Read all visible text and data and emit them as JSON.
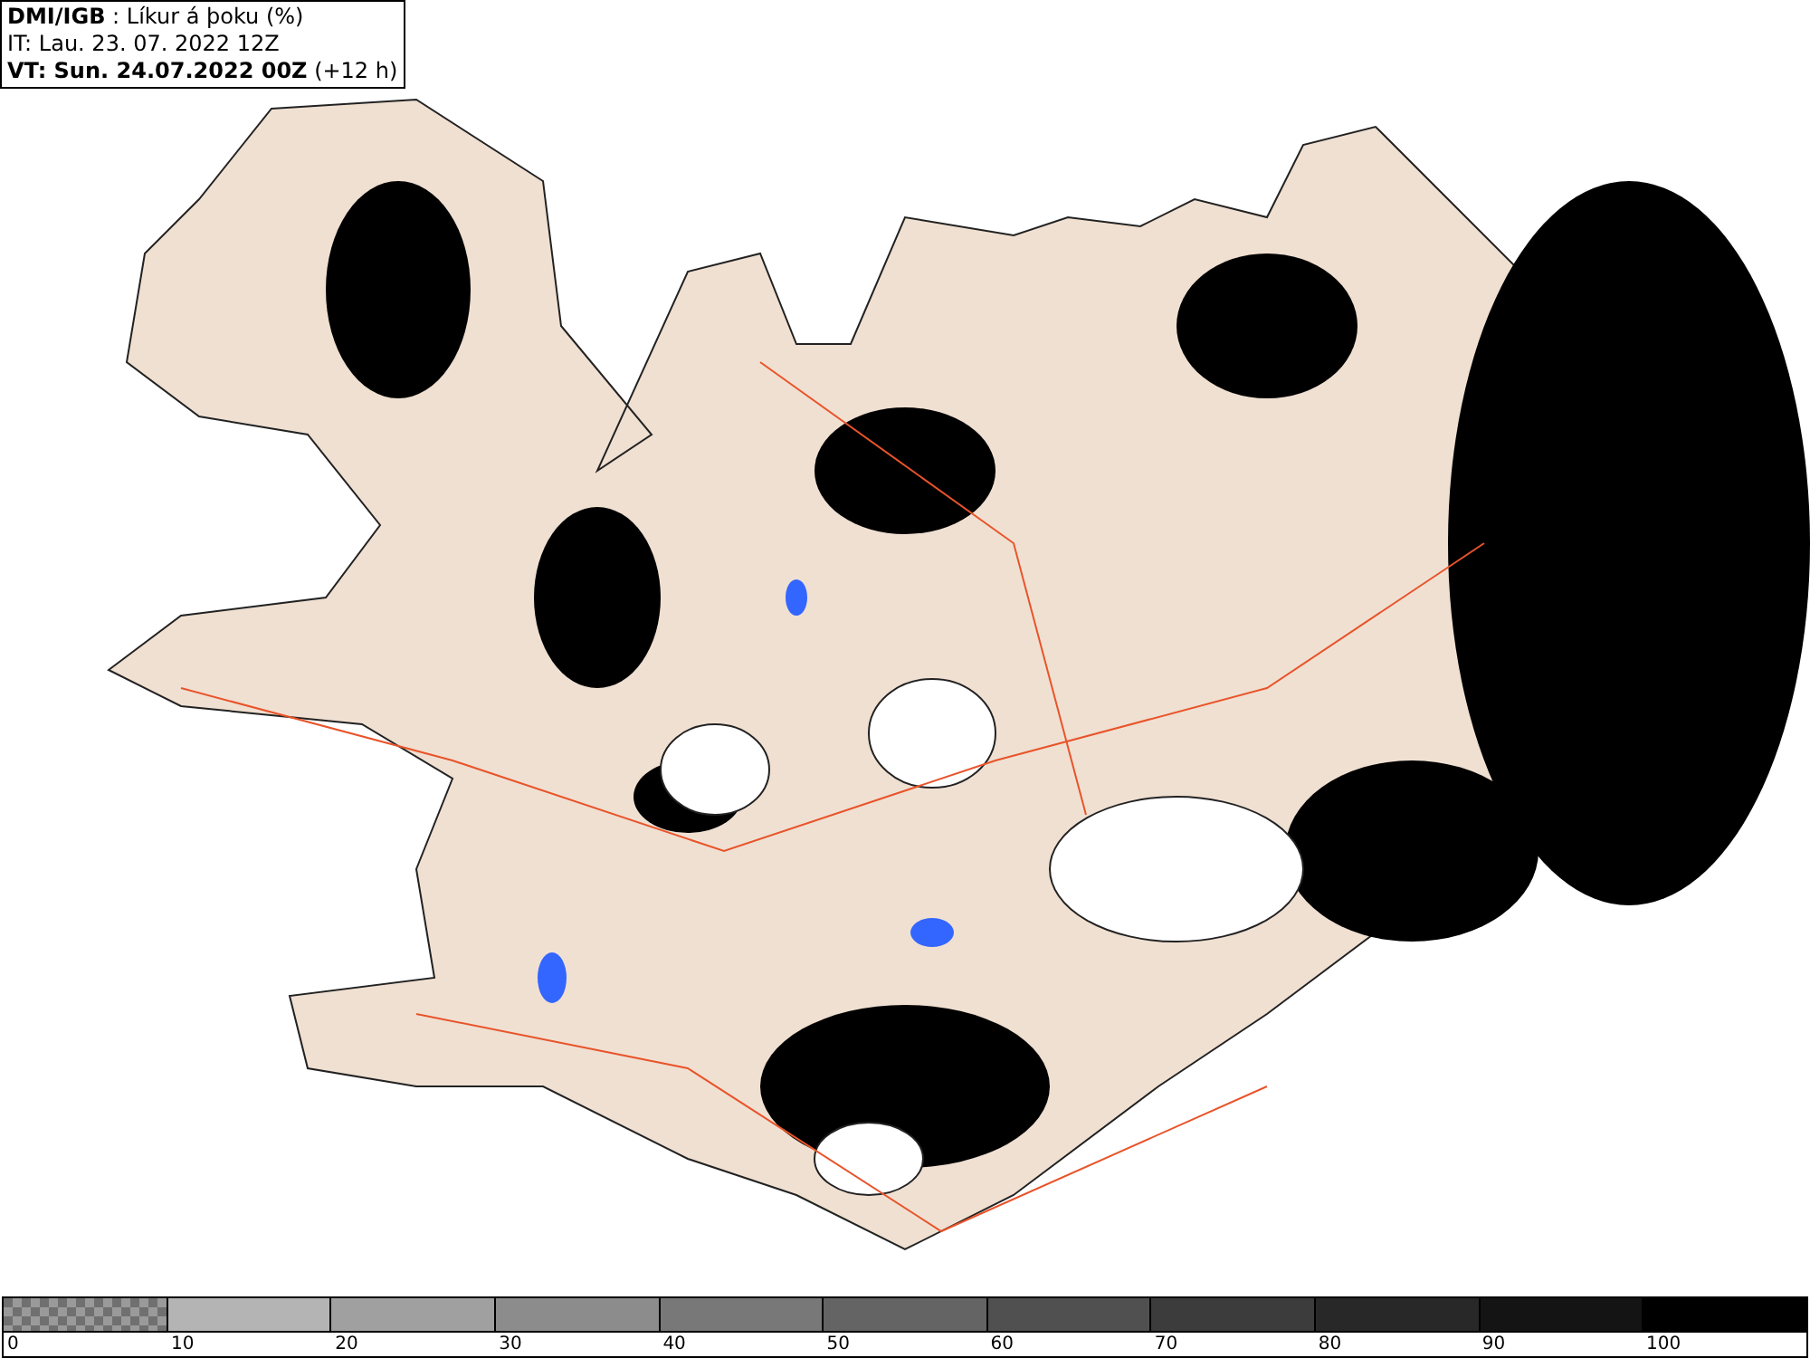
{
  "header": {
    "lines": [
      "**DMI/IGB** : Líkur á þoku (%)",
      "IT: Lau. 23. 07. 2022 12Z",
      "**VT: Sun. 24.07.2022 00Z** (+12 h)"
    ]
  },
  "legend": {
    "segments": [
      {
        "kind": "checkered",
        "color": "#9a9a9a",
        "label": "0"
      },
      {
        "kind": "solid",
        "color": "#b4b4b4",
        "label": "10"
      },
      {
        "kind": "solid",
        "color": "#a0a0a0",
        "label": "20"
      },
      {
        "kind": "solid",
        "color": "#8c8c8c",
        "label": "30"
      },
      {
        "kind": "solid",
        "color": "#787878",
        "label": "40"
      },
      {
        "kind": "solid",
        "color": "#646464",
        "label": "50"
      },
      {
        "kind": "solid",
        "color": "#505050",
        "label": "60"
      },
      {
        "kind": "solid",
        "color": "#3c3c3c",
        "label": "70"
      },
      {
        "kind": "solid",
        "color": "#282828",
        "label": "80"
      },
      {
        "kind": "solid",
        "color": "#141414",
        "label": "90"
      },
      {
        "kind": "solid",
        "color": "#000000",
        "label": "100"
      }
    ]
  }
}
